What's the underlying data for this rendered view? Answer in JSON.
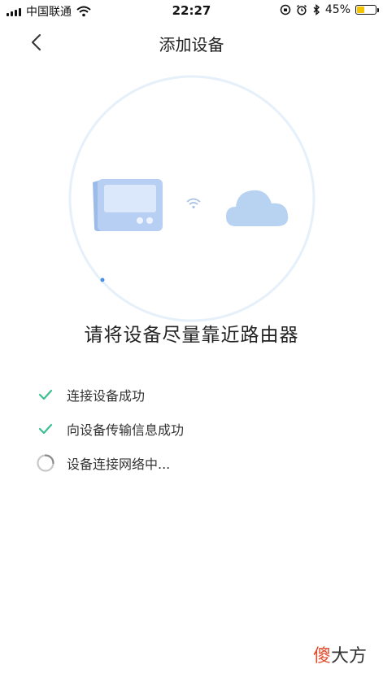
{
  "status_bar": {
    "carrier": "中国联通",
    "time": "22:27",
    "battery_percent": "45%",
    "battery_level": 0.45,
    "battery_color": "#f5c400"
  },
  "nav": {
    "title": "添加设备",
    "back_icon": "chevron-left-icon"
  },
  "illustration": {
    "progress": 0.86,
    "accent": "#4a90e2"
  },
  "hint_text": "请将设备尽量靠近路由器",
  "steps": [
    {
      "label": "连接设备成功",
      "status": "done",
      "icon": "check-icon"
    },
    {
      "label": "向设备传输信息成功",
      "status": "done",
      "icon": "check-icon"
    },
    {
      "label": "设备连接网络中...",
      "status": "loading",
      "icon": "spinner-icon"
    }
  ],
  "colors": {
    "check": "#3cbf8f",
    "spinner": "#9a9a9a",
    "ring": "#e3eef8",
    "device": "#a9c6f0"
  },
  "watermark": {
    "accent_char": "傻",
    "rest": "大方"
  }
}
